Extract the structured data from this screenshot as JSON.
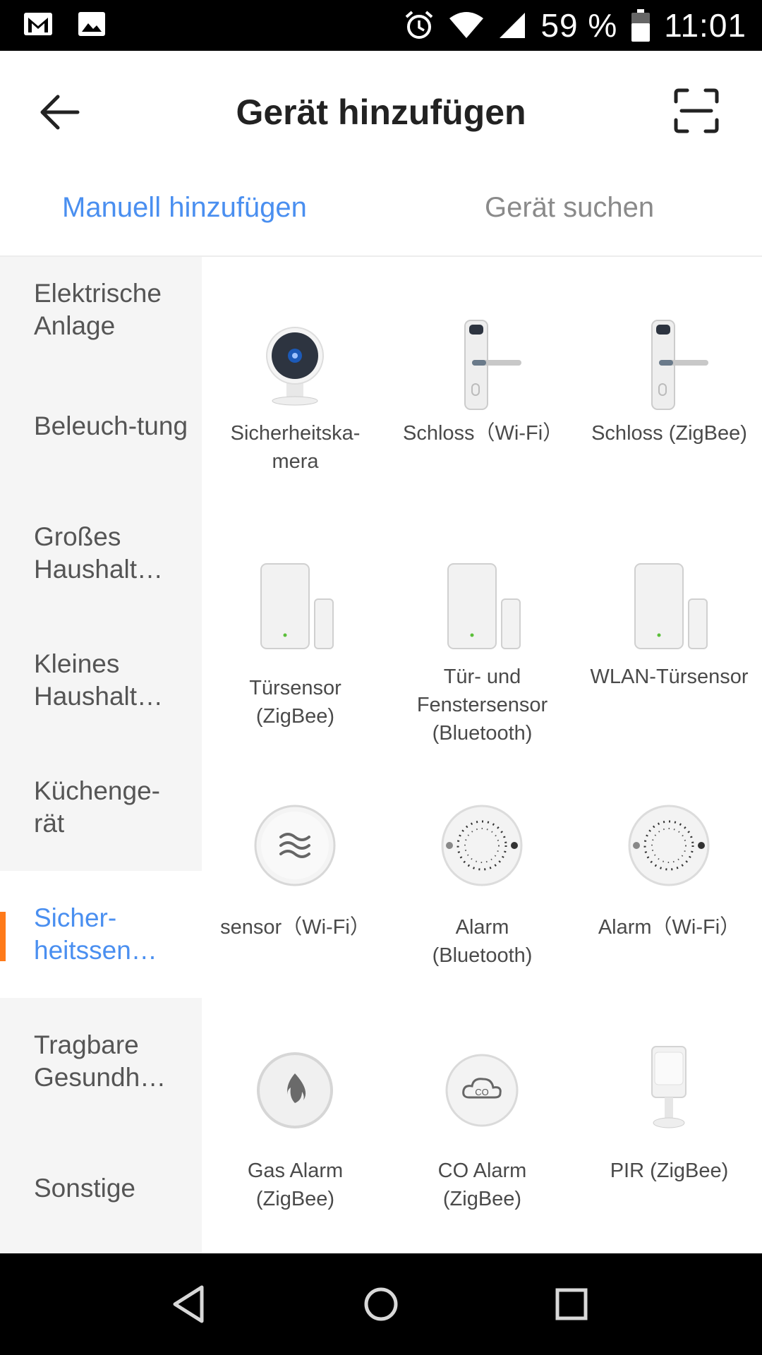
{
  "status_bar": {
    "battery": "59 %",
    "time": "11:01",
    "icons": [
      "gmail-icon",
      "gallery-icon",
      "alarm-icon",
      "wifi-icon",
      "signal-icon",
      "battery-icon"
    ]
  },
  "header": {
    "title": "Gerät hinzufügen",
    "back_icon": "back-arrow-icon",
    "scan_icon": "scan-icon"
  },
  "tabs": [
    {
      "label": "Manuell hinzufügen",
      "active": true
    },
    {
      "label": "Gerät suchen",
      "active": false
    }
  ],
  "categories": [
    {
      "label": "Elektrische Anlage",
      "active": false
    },
    {
      "label": "Beleuch-tung",
      "active": false
    },
    {
      "label": "Großes Haushalt…",
      "active": false
    },
    {
      "label": "Kleines Haushalt…",
      "active": false
    },
    {
      "label": "Küchenge-rät",
      "active": false
    },
    {
      "label": "Sicher-heitssen…",
      "active": true
    },
    {
      "label": "Tragbare Gesundh…",
      "active": false
    },
    {
      "label": "Sonstige",
      "active": false
    }
  ],
  "devices": [
    {
      "label": "Sicherheitska-mera",
      "icon": "security-camera"
    },
    {
      "label": "Schloss（Wi-Fi）",
      "icon": "door-lock"
    },
    {
      "label": "Schloss (ZigBee)",
      "icon": "door-lock"
    },
    {
      "label": "Türsensor (ZigBee)",
      "icon": "door-sensor"
    },
    {
      "label": "Tür- und Fenstersensor (Bluetooth)",
      "icon": "door-sensor"
    },
    {
      "label": "WLAN-Türsensor",
      "icon": "door-sensor"
    },
    {
      "label": "sensor（Wi-Fi）",
      "icon": "water-sensor"
    },
    {
      "label": "Alarm (Bluetooth)",
      "icon": "smoke-alarm"
    },
    {
      "label": "Alarm（Wi-Fi）",
      "icon": "smoke-alarm"
    },
    {
      "label": "Gas Alarm (ZigBee)",
      "icon": "gas-alarm"
    },
    {
      "label": "CO Alarm (ZigBee)",
      "icon": "co-alarm"
    },
    {
      "label": "PIR (ZigBee)",
      "icon": "pir-sensor"
    }
  ],
  "colors": {
    "accent": "#4a8ff0",
    "indicator": "#ff7a1a",
    "sidebar_bg": "#f5f5f5"
  },
  "nav": [
    "nav-back-icon",
    "nav-home-icon",
    "nav-recents-icon"
  ]
}
